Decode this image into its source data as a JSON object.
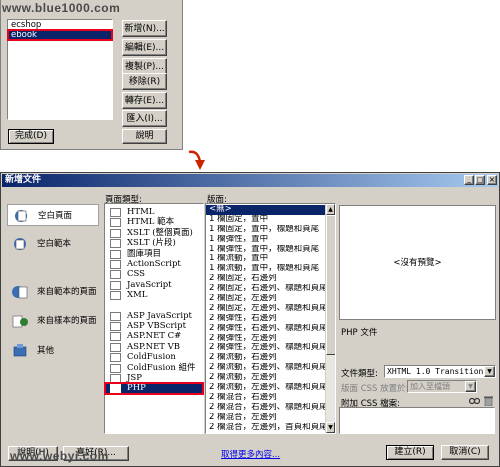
{
  "watermarks": {
    "top": "www.blue1000.com",
    "bottom": "www.webyi.com"
  },
  "site_dialog": {
    "list_items": [
      {
        "label": "ecshop",
        "selected": false
      },
      {
        "label": "ebook",
        "selected": true
      }
    ],
    "buttons": {
      "new": "新增(N)...",
      "edit": "編輯(E)...",
      "duplicate": "複製(P)...",
      "remove": "移除(R)",
      "export": "轉存(E)...",
      "import": "匯入(I)...",
      "done": "完成(D)",
      "help": "說明"
    }
  },
  "new_document": {
    "title": "新增文件",
    "title_controls": [
      "_",
      "□",
      "×"
    ],
    "categories": [
      {
        "label": "空白頁面",
        "icon": "blank-page-icon",
        "selected": true
      },
      {
        "label": "空白範本",
        "icon": "blank-template-icon",
        "selected": false
      },
      {
        "label": "來自範本的頁面",
        "icon": "page-from-template-icon",
        "selected": false
      },
      {
        "label": "來自樣本的頁面",
        "icon": "page-from-sample-icon",
        "selected": false
      },
      {
        "label": "其他",
        "icon": "other-icon",
        "selected": false
      }
    ],
    "page_type": {
      "header": "頁面類型:",
      "items": [
        {
          "label": "HTML",
          "selected": false
        },
        {
          "label": "HTML 範本",
          "selected": false
        },
        {
          "label": "XSLT (整個頁面)",
          "selected": false
        },
        {
          "label": "XSLT (片段)",
          "selected": false
        },
        {
          "label": "圖庫項目",
          "selected": false
        },
        {
          "label": "ActionScript",
          "selected": false
        },
        {
          "label": "CSS",
          "selected": false
        },
        {
          "label": "JavaScript",
          "selected": false
        },
        {
          "label": "XML",
          "selected": false
        },
        {
          "label": "",
          "selected": false
        },
        {
          "label": "ASP JavaScript",
          "selected": false
        },
        {
          "label": "ASP VBScript",
          "selected": false
        },
        {
          "label": "ASP.NET C#",
          "selected": false
        },
        {
          "label": "ASP.NET VB",
          "selected": false
        },
        {
          "label": "ColdFusion",
          "selected": false
        },
        {
          "label": "ColdFusion 組件",
          "selected": false
        },
        {
          "label": "JSP",
          "selected": false
        },
        {
          "label": "PHP",
          "selected": true
        }
      ]
    },
    "layout": {
      "header": "版面:",
      "items": [
        "<無>",
        "1 欄固定，置中",
        "1 欄固定，置中，標題和頁尾",
        "1 欄彈性，置中",
        "1 欄彈性，置中，標題和頁尾",
        "1 欄流動，置中",
        "1 欄流動，置中，標題和頁尾",
        "2 欄固定，右邊列",
        "2 欄固定，右邊列、標題和頁尾",
        "2 欄固定，左邊列",
        "2 欄固定，左邊列、標題和頁尾",
        "2 欄彈性，右邊列",
        "2 欄彈性，右邊列、標題和頁尾",
        "2 欄彈性，左邊列",
        "2 欄彈性，左邊列、標題和頁尾",
        "2 欄流動，右邊列",
        "2 欄流動，右邊列、標題和頁尾",
        "2 欄流動，左邊列",
        "2 欄流動，左邊列、標題和頁尾",
        "2 欄混合，右邊列",
        "2 欄混合，右邊列、標題和頁尾",
        "2 欄混合，左邊列",
        "2 欄混合，左邊列，首頁和頁尾"
      ]
    },
    "preview": {
      "placeholder": "<沒有預覽>",
      "description": "PHP 文件"
    },
    "doctype": {
      "label": "文件類型:",
      "value": "XHTML 1.0 Transitional"
    },
    "layout_css": {
      "label": "版面 CSS 放置於:",
      "value": "加入至檔頭"
    },
    "attach_css": {
      "label": "附加 CSS 檔案:"
    },
    "footer": {
      "help": "說明(H)",
      "preferences": "喜好(R)...",
      "more_content": "取得更多內容...",
      "create": "建立(R)",
      "cancel": "取消(C)"
    }
  },
  "colors": {
    "selection": "#0a246a",
    "highlight_red": "#e8001c",
    "titlebar_start": "#0a246a",
    "titlebar_end": "#a6caf0",
    "arrow": "#cc2200",
    "link": "#0000ee"
  }
}
